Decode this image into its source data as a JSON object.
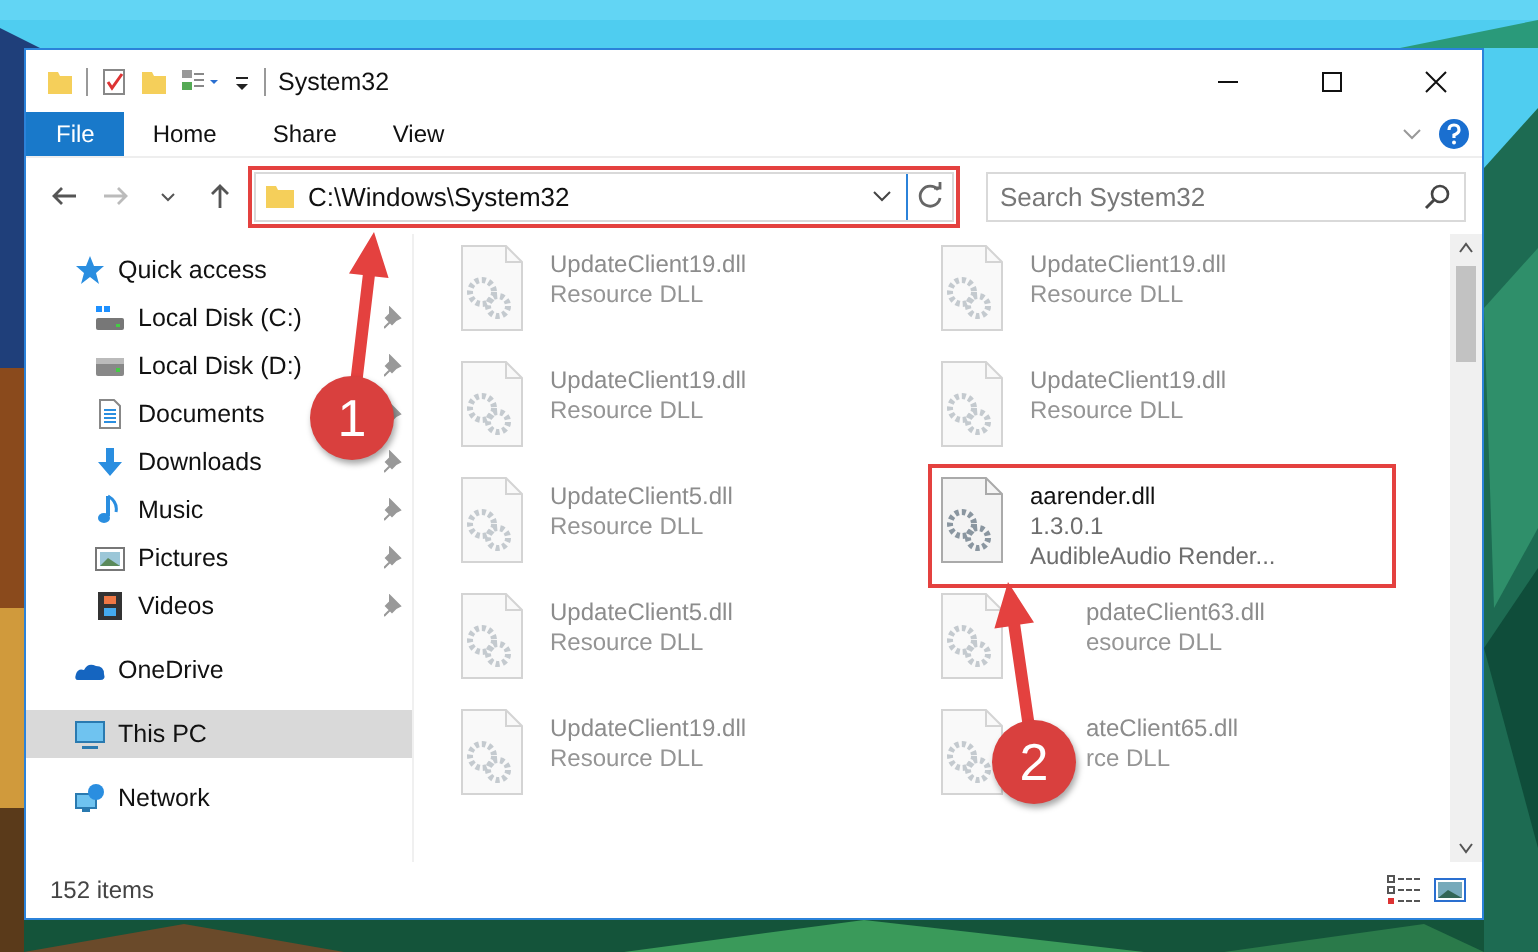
{
  "window": {
    "title": "System32"
  },
  "ribbon_tabs": [
    {
      "label": "File",
      "kind": "file"
    },
    {
      "label": "Home",
      "kind": "tab"
    },
    {
      "label": "Share",
      "kind": "tab"
    },
    {
      "label": "View",
      "kind": "tab"
    }
  ],
  "address_bar": {
    "path": "C:\\Windows\\System32"
  },
  "search": {
    "placeholder": "Search System32"
  },
  "sidebar": {
    "items": [
      {
        "label": "Quick access",
        "kind": "root",
        "pinned": false,
        "selected": false
      },
      {
        "label": "Local Disk (C:)",
        "kind": "child",
        "pinned": true,
        "selected": false
      },
      {
        "label": "Local Disk (D:)",
        "kind": "child",
        "pinned": true,
        "selected": false
      },
      {
        "label": "Documents",
        "kind": "child",
        "pinned": true,
        "selected": false
      },
      {
        "label": "Downloads",
        "kind": "child",
        "pinned": true,
        "selected": false
      },
      {
        "label": "Music",
        "kind": "child",
        "pinned": true,
        "selected": false
      },
      {
        "label": "Pictures",
        "kind": "child",
        "pinned": true,
        "selected": false
      },
      {
        "label": "Videos",
        "kind": "child",
        "pinned": true,
        "selected": false
      },
      {
        "label": "OneDrive",
        "kind": "root",
        "pinned": false,
        "selected": false
      },
      {
        "label": "This PC",
        "kind": "root",
        "pinned": false,
        "selected": true
      },
      {
        "label": "Network",
        "kind": "root",
        "pinned": false,
        "selected": false
      }
    ]
  },
  "files": [
    {
      "name": "UpdateClient19.dll",
      "lines": [
        "Resource DLL"
      ],
      "blurred": true,
      "covered": false
    },
    {
      "name": "UpdateClient19.dll",
      "lines": [
        "Resource DLL"
      ],
      "blurred": true,
      "covered": false
    },
    {
      "name": "UpdateClient19.dll",
      "lines": [
        "Resource DLL"
      ],
      "blurred": true,
      "covered": false
    },
    {
      "name": "UpdateClient19.dll",
      "lines": [
        "Resource DLL"
      ],
      "blurred": true,
      "covered": false
    },
    {
      "name": "UpdateClient5.dll",
      "lines": [
        "Resource DLL"
      ],
      "blurred": true,
      "covered": false
    },
    {
      "name": "aarender.dll",
      "lines": [
        "1.3.0.1",
        "AudibleAudio Render..."
      ],
      "blurred": false,
      "covered": false
    },
    {
      "name": "UpdateClient5.dll",
      "lines": [
        "Resource DLL"
      ],
      "blurred": true,
      "covered": false
    },
    {
      "name": "pdateClient63.dll",
      "lines": [
        "esource DLL"
      ],
      "blurred": true,
      "covered": true
    },
    {
      "name": "UpdateClient19.dll",
      "lines": [
        "Resource DLL"
      ],
      "blurred": true,
      "covered": false
    },
    {
      "name": "ateClient65.dll",
      "lines": [
        "rce DLL"
      ],
      "blurred": true,
      "covered": true
    }
  ],
  "status_bar": {
    "count": "152 items"
  },
  "annotations": [
    {
      "number": "1"
    },
    {
      "number": "2"
    }
  ]
}
